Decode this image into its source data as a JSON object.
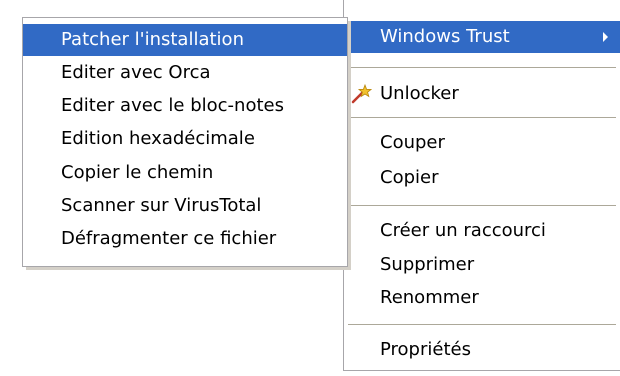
{
  "main_menu": {
    "items": {
      "windows_trust": "Windows Trust",
      "unlocker": "Unlocker",
      "couper": "Couper",
      "copier": "Copier",
      "creer_raccourci": "Créer un raccourci",
      "supprimer": "Supprimer",
      "renommer": "Renommer",
      "proprietes": "Propriétés"
    }
  },
  "sub_menu": {
    "items": [
      "Patcher l'installation",
      "Editer avec Orca",
      "Editer avec le bloc-notes",
      "Edition hexadécimale",
      "Copier le chemin",
      "Scanner sur VirusTotal",
      "Défragmenter ce fichier"
    ],
    "selected_index": 0
  },
  "icons": {
    "unlocker": "magic-wand-star-icon",
    "submenu_arrow": "triangle-right-icon"
  },
  "colors": {
    "selection": "#316ac5",
    "separator": "#aca899",
    "border": "#a7a6aa"
  }
}
